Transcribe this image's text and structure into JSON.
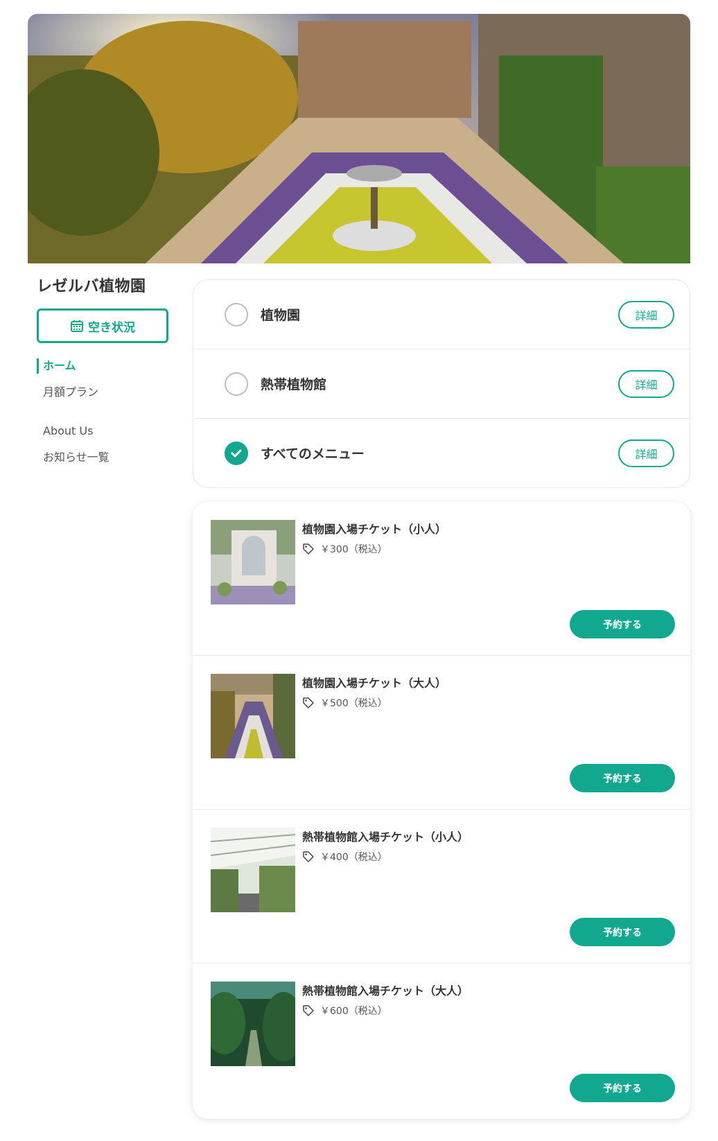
{
  "hero": {
    "image": "garden-terrace-photo"
  },
  "sidebar": {
    "title": "レゼルバ植物園",
    "availability_button": "空き状況",
    "availability_icon": "calendar-icon",
    "nav": [
      {
        "label": "ホーム",
        "active": true
      },
      {
        "label": "月額プラン",
        "active": false
      },
      {
        "label": "About Us",
        "active": false
      },
      {
        "label": "お知らせ一覧",
        "active": false
      }
    ]
  },
  "categories": [
    {
      "label": "植物園",
      "checked": false,
      "detail": "詳細"
    },
    {
      "label": "熱帯植物館",
      "checked": false,
      "detail": "詳細"
    },
    {
      "label": "すべてのメニュー",
      "checked": true,
      "detail": "詳細"
    }
  ],
  "products": [
    {
      "name": "植物園入場チケット（小人）",
      "price": "￥300（税込）",
      "button": "予約する",
      "image": "gazebo-photo"
    },
    {
      "name": "植物園入場チケット（大人）",
      "price": "￥500（税込）",
      "button": "予約する",
      "image": "garden-terrace-photo"
    },
    {
      "name": "熱帯植物館入場チケット（小人）",
      "price": "￥400（税込）",
      "button": "予約する",
      "image": "greenhouse-photo"
    },
    {
      "name": "熱帯植物館入場チケット（大人）",
      "price": "￥600（税込）",
      "button": "予約する",
      "image": "jungle-path-photo"
    }
  ],
  "colors": {
    "accent": "#12a88f"
  }
}
